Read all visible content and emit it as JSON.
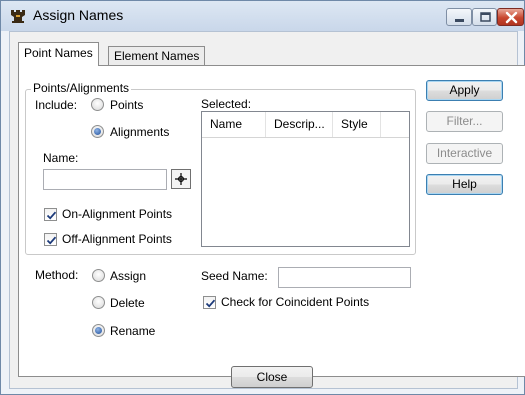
{
  "window": {
    "title": "Assign Names",
    "icon": "chess-rook-icon",
    "controls": {
      "minimize": "minimize-icon",
      "maximize": "maximize-icon",
      "close": "close-icon"
    }
  },
  "tabs": [
    {
      "label": "Point Names",
      "active": true
    },
    {
      "label": "Element Names",
      "active": false
    }
  ],
  "points_group": {
    "title": "Points/Alignments",
    "include_label": "Include:",
    "include_options": [
      {
        "label": "Points",
        "selected": false
      },
      {
        "label": "Alignments",
        "selected": true
      }
    ],
    "name_label": "Name:",
    "name_value": "",
    "pick_icon": "crosshair-icon",
    "on_alignment_points": {
      "label": "On-Alignment Points",
      "checked": true
    },
    "off_alignment_points": {
      "label": "Off-Alignment Points",
      "checked": true
    },
    "selected_label": "Selected:",
    "columns": [
      "Name",
      "Descrip...",
      "Style"
    ],
    "rows": []
  },
  "method": {
    "label": "Method:",
    "options": [
      {
        "label": "Assign",
        "selected": false
      },
      {
        "label": "Delete",
        "selected": false
      },
      {
        "label": "Rename",
        "selected": true
      }
    ],
    "seed_name_label": "Seed Name:",
    "seed_name_value": "",
    "coincident": {
      "label": "Check for Coincident Points",
      "checked": true
    }
  },
  "buttons": {
    "apply": "Apply",
    "filter": "Filter...",
    "interactive": "Interactive",
    "help": "Help",
    "close": "Close"
  }
}
